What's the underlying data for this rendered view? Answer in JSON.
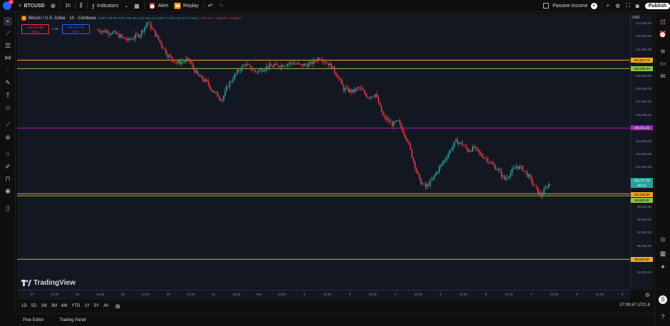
{
  "topbar": {
    "badge": "11",
    "symbol": "BTCUSD",
    "interval": "1h",
    "indicators": "Indicators",
    "alert": "Alert",
    "replay": "Replay",
    "passive_income": "Passive Income",
    "publish": "Publish"
  },
  "legend": {
    "title": "Bitcoin / U.S. Dollar · 1h · Coinbase",
    "ohlc": "O100,739.99 H100,796.40 L100,280.00 C100,777.25 +29.37 (+0.03%)",
    "vol": "Vol 147.7 −518.06 (−0.51%)"
  },
  "trade": {
    "sell_price": "100,739.99",
    "sell_label": "SELL",
    "spread": "1.76",
    "buy_price": "100,741.76",
    "buy_label": "BUY"
  },
  "price_axis": {
    "currency": "USD",
    "labels": [
      "113,000.00",
      "112,000.00",
      "111,000.00",
      "110,000.00",
      "109,000.00",
      "108,000.00",
      "107,000.00",
      "106,000.00",
      "105,000.00",
      "104,000.00",
      "103,000.00",
      "102,000.00",
      "101,000.00",
      "100,000.00",
      "99,000.00",
      "98,000.00",
      "97,000.00",
      "96,000.00",
      "95,000.00",
      "94,000.00"
    ],
    "tags": {
      "orange_top": "110,201.70",
      "green_top": "109,558.00",
      "purple": "105,011.32",
      "last_price": "100,777.25",
      "countdown": "50:13",
      "orange_bottom": "100,000.00",
      "green_bottom": "99,950.00",
      "orange_low": "95,000.00"
    }
  },
  "time_axis": {
    "labels": [
      "27",
      "12:00",
      "28",
      "12:00",
      "29",
      "12:00",
      "30",
      "12:00",
      "31",
      "12:00",
      "Nov",
      "12:00",
      "2",
      "12:00",
      "3",
      "12:00",
      "4",
      "12:00",
      "5",
      "12:00",
      "6",
      "12:00",
      "7",
      "12:00",
      "8",
      "12:00",
      "9"
    ]
  },
  "range_bar": {
    "items": [
      "1D",
      "5D",
      "1M",
      "3M",
      "6M",
      "YTD",
      "1Y",
      "5Y",
      "All"
    ],
    "clock": "07:09:47 UTC-8"
  },
  "bottom_panel": {
    "tabs": [
      "Pine Editor",
      "Trading Panel"
    ]
  },
  "branding": {
    "name": "TradingView"
  },
  "colors": {
    "up": "#26a69a",
    "down": "#f23645",
    "orange_line": "#f5a623",
    "green_line": "#8bc34a",
    "purple_line": "#9c27b0"
  },
  "icons": {
    "left": [
      "crosshair-icon",
      "trend-line-icon",
      "horizontal-lines-icon",
      "pitchfork-icon",
      "fib-icon",
      "brush-icon",
      "text-icon",
      "emoji-icon",
      "ruler-icon",
      "zoom-icon",
      "magnet-icon",
      "lock-drawing-icon",
      "lock-icon",
      "eye-icon",
      "trash-icon"
    ],
    "right": [
      "watchlist-icon",
      "alerts-icon",
      "layers-icon",
      "calendar-icon",
      "chat-icon",
      "notifications-icon",
      "calendar-2-icon",
      "ideas-icon",
      "apps-icon",
      "help-icon"
    ]
  }
}
